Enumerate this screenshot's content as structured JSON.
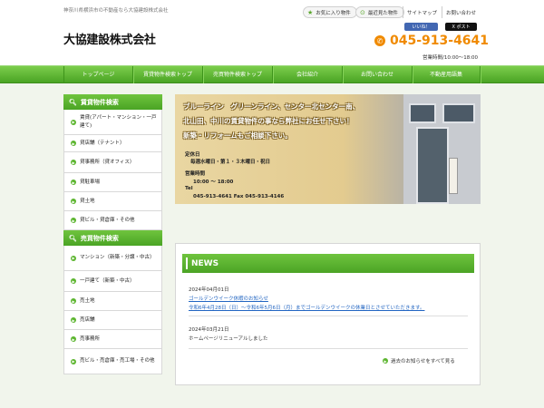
{
  "header": {
    "tagline": "神奈川県横浜市の不動産なら大協建設株式会社",
    "logo": "大協建設株式会社",
    "tools": {
      "favorites": "お気に入り物件",
      "recent": "最近見た物件",
      "sitemap": "サイトマップ",
      "contact": "お問い合わせ"
    },
    "sns": {
      "like": "いいね！",
      "post": "X ポスト"
    },
    "phone": "045-913-4641",
    "hours": "営業時間/10:00～18:00"
  },
  "nav": {
    "items": [
      "トップページ",
      "賃貸物件検索トップ",
      "売買物件検索トップ",
      "会社紹介",
      "お問い合わせ",
      "不動産用語集"
    ]
  },
  "sidebar": {
    "rent": {
      "title": "賃貸物件検索",
      "items": [
        "賃貸(アパート・マンション・一戸建て)",
        "貸店舗（テナント）",
        "貸事務所（貸オフィス）",
        "貸駐車場",
        "貸土地",
        "貸ビル・貸倉庫・その他"
      ]
    },
    "sale": {
      "title": "売買物件検索",
      "items": [
        "マンション（新築・分譲・中古）",
        "一戸建て（新築・中古）",
        "売土地",
        "売店舗",
        "売事務所",
        "売ビル・売倉庫・売工場・その他"
      ]
    }
  },
  "banner": {
    "line1": "ブルーライン　グリーンライン、センター北センター南、",
    "line2": "北山田、中川の賃貸物件の事なら弊社にお任せ下さい！",
    "line3": "新築・リフォームもご相談下さい。",
    "closed_label": "定休日",
    "closed_days": "毎週水曜日・第１・３木曜日・祝日",
    "hours_label": "営業時間",
    "hours": "10:00 ～ 18:00",
    "tel_label": "Tel",
    "tel_fax": "045-913-4641  Fax  045-913-4146"
  },
  "news": {
    "title": "NEWS",
    "entries": [
      {
        "date": "2024年04月01日",
        "link": "ゴールデンウイーク休暇のお知らせ",
        "detail": "令和6年4月28日（日）～令和6年5月6日（月）までゴールデンウイークの休業日とさせていただきます。"
      },
      {
        "date": "2024年03月21日",
        "text": "ホームページリニューアルしました"
      }
    ],
    "more": "過去のお知らせをすべて見る"
  },
  "colors": {
    "accent_green": "#4aa424",
    "phone_orange": "#f08a00",
    "link_blue": "#2366c2",
    "background": "#f1f5ec"
  }
}
